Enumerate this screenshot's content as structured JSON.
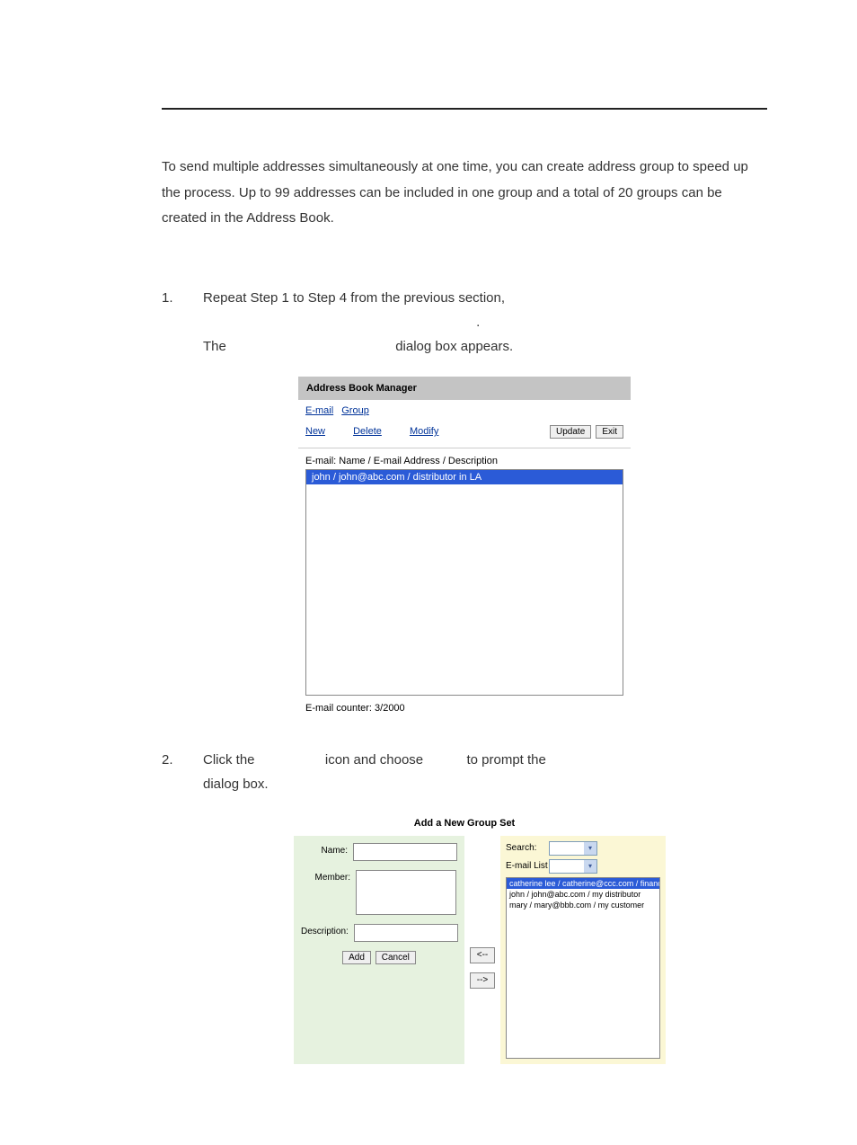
{
  "intro": "To send multiple addresses simultaneously at one time, you can create address group to speed up the process.   Up to 99 addresses can be included in one group and a total of 20 groups can be created in the Address Book.",
  "steps": {
    "s1_num": "1.",
    "s1a": "Repeat Step 1 to Step 4 from the previous section,",
    "s1dot": ".",
    "s1b_pre": "The",
    "s1b_post": "dialog box appears.",
    "s2_num": "2.",
    "s2a": "Click the",
    "s2b": "icon and choose",
    "s2c": "to prompt the",
    "s2d": "dialog box."
  },
  "abm": {
    "title": "Address Book Manager",
    "tab_email": "E-mail",
    "tab_group": "Group",
    "link_new": "New",
    "link_delete": "Delete",
    "link_modify": "Modify",
    "btn_update": "Update",
    "btn_exit": "Exit",
    "list_header": "E-mail: Name / E-mail Address / Description",
    "row0": "john / john@abc.com / distributor in LA",
    "counter": "E-mail counter: 3/2000"
  },
  "grp": {
    "title": "Add a New Group Set",
    "lbl_name": "Name:",
    "lbl_member": "Member:",
    "lbl_desc": "Description:",
    "btn_add": "Add",
    "btn_cancel": "Cancel",
    "btn_left": "<--",
    "btn_right": "-->",
    "lbl_search": "Search:",
    "lbl_emaillist": "E-mail List",
    "rows": {
      "r0": "catherine lee / catherine@ccc.com / finance",
      "r1": "john / john@abc.com / my distributor",
      "r2": "mary / mary@bbb.com / my customer"
    }
  }
}
